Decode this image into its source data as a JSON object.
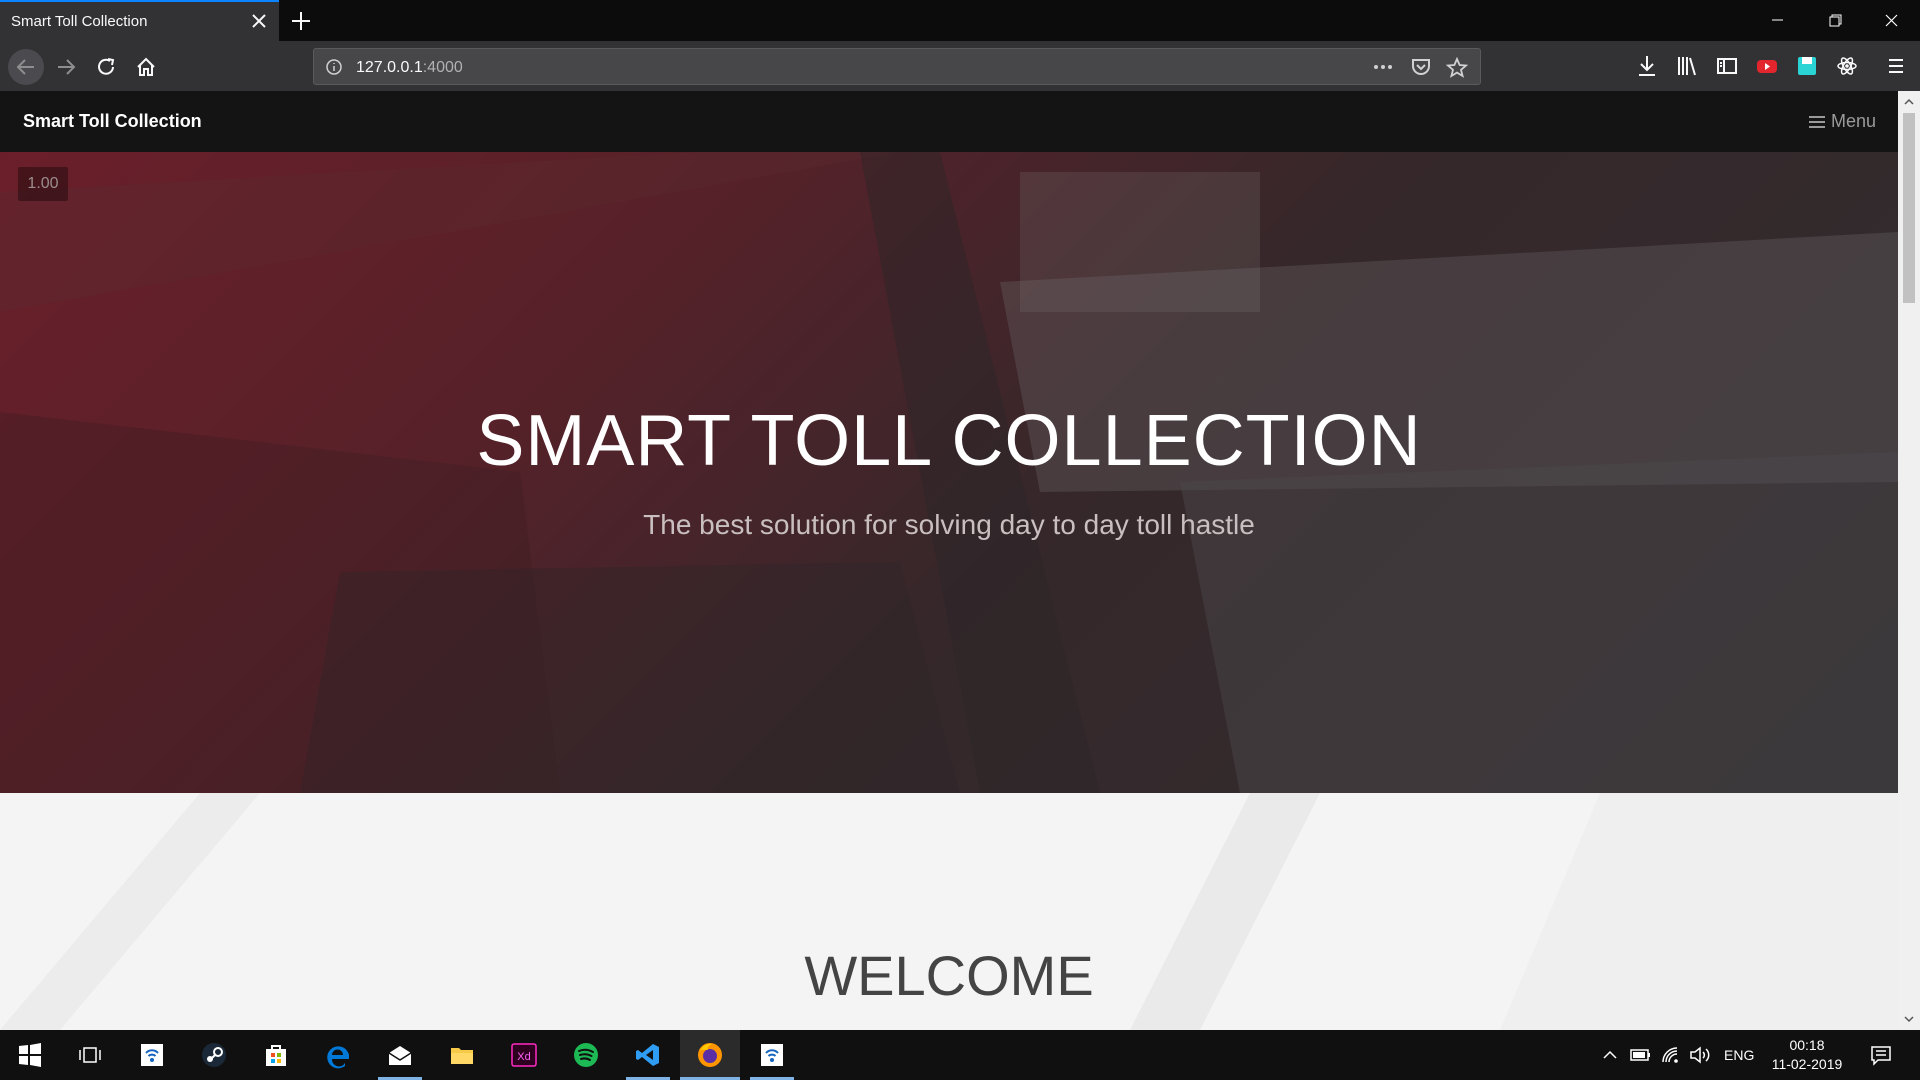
{
  "browser": {
    "tab_title": "Smart Toll Collection",
    "url_host": "127.0.0.1",
    "url_port": ":4000"
  },
  "site": {
    "brand": "Smart Toll Collection",
    "menu_label": "Menu",
    "badge": "1.00",
    "hero_title": "SMART TOLL COLLECTION",
    "hero_subtitle": "The best solution for solving day to day toll hastle",
    "welcome_title": "WELCOME"
  },
  "taskbar": {
    "language": "ENG",
    "time": "00:18",
    "date": "11-02-2019",
    "apps": [
      "start",
      "task-view",
      "connect",
      "steam",
      "store",
      "edge",
      "mail",
      "file-explorer",
      "adobe-xd",
      "spotify",
      "vs-code",
      "firefox",
      "connect"
    ]
  },
  "colors": {
    "accent": "#0a84ff",
    "hero_red": "#8c1626",
    "taskbar_active": "#7fb2e5"
  }
}
